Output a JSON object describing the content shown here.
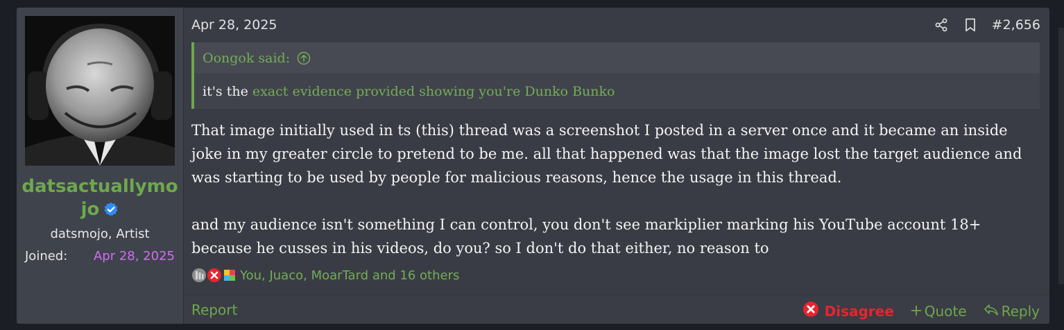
{
  "user": {
    "name": "datsactuallymojo",
    "name_line1": "datsactuallymo",
    "name_line2": "jo",
    "title": "datsmojo, Artist",
    "joined_label": "Joined:",
    "joined_date": "Apr 28, 2025"
  },
  "post": {
    "date": "Apr 28, 2025",
    "number": "#2,656",
    "quote": {
      "author_line": "Oongok said:",
      "prefix": "it's the",
      "highlight": "exact evidence provided showing you're Dunko Bunko"
    },
    "paragraphs": [
      "That image initially used in ts (this) thread was a screenshot I posted in a server once and it became an inside joke in my greater circle to pretend to be me. all that happened was that the image lost the target audience and was starting to be used by people for malicious reasons, hence the usage in this thread.",
      "and my audience isn't something I can control, you don't see markiplier marking his YouTube account 18+ because he cusses in his videos, do you? so I don't do that either, no reason to"
    ],
    "reactions_text": "You, Juaco, MoarTard and 16 others"
  },
  "footer": {
    "report": "Report",
    "disagree": "Disagree",
    "quote": "Quote",
    "reply": "Reply"
  },
  "icons": [
    "share-icon",
    "bookmark-icon",
    "quote-jump-icon",
    "verified-icon",
    "disagree-x-icon",
    "quote-plus-icon",
    "reply-icon"
  ],
  "colors": {
    "accent": "#6ea84d",
    "joined_date": "#d36df2",
    "disagree": "#e8242e",
    "verified": "#2f8cf0"
  }
}
